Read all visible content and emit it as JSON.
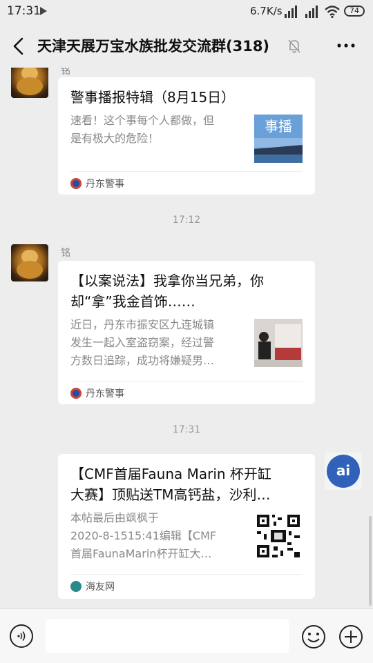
{
  "status_bar": {
    "time": "17:31",
    "speed": "6.7K/s",
    "battery": "74"
  },
  "header": {
    "title": "天津天展万宝水族批发交流群(318)"
  },
  "messages": [
    {
      "sender": "铭",
      "card": {
        "title": "警事播报特辑（8月15日）",
        "desc_lines": [
          "速看！这个事每个人都做，但",
          "是有极大的危险！"
        ],
        "source": "丹东警事",
        "thumb_text": "事播"
      }
    },
    {
      "timestamp": "17:12"
    },
    {
      "sender": "铭",
      "card": {
        "title_lines": [
          "【以案说法】我拿你当兄弟，你",
          "却“拿”我金首饰……"
        ],
        "desc_lines": [
          "近日，丹东市振安区九连城镇",
          "发生一起入室盗窃案，经过警",
          "方数日追踪，成功将嫌疑男…"
        ],
        "source": "丹东警事"
      }
    },
    {
      "timestamp": "17:31"
    },
    {
      "card": {
        "title_lines": [
          "【CMF首届Fauna Marin 杯开缸",
          "大赛】顶贴送TM高钙盐，沙利…"
        ],
        "desc_lines": [
          "本帖最后由飒枫于",
          "2020-8-1515:41编辑【CMF",
          "首届FaunaMarin杯开缸大…"
        ],
        "source": "海友网"
      },
      "avatar_text": "ai"
    }
  ],
  "colors": {
    "background": "#ededed",
    "card": "#ffffff",
    "police_icon": "#1f4fa8",
    "haiyou_icon": "#2a8a8a"
  }
}
